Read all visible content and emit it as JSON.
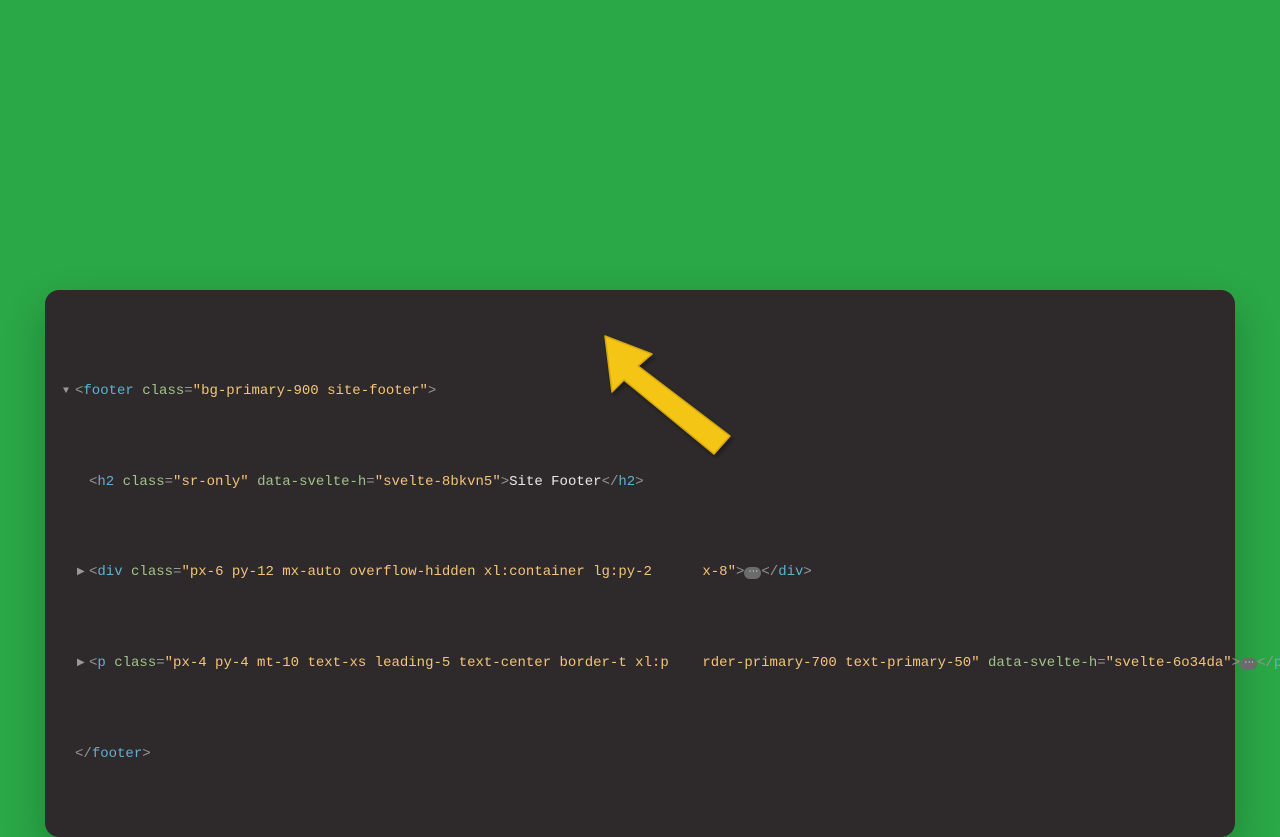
{
  "code": {
    "line1": {
      "disclosure": "▼",
      "open_bracket": "<",
      "tag": "footer",
      "attr1_name": "class",
      "attr1_val": "bg-primary-900 site-footer",
      "close_bracket": ">"
    },
    "line2": {
      "open_bracket": "<",
      "tag": "h2",
      "attr1_name": "class",
      "attr1_val": "sr-only",
      "attr2_name": "data-svelte-h",
      "attr2_val": "svelte-8bkvn5",
      "close_bracket": ">",
      "text": "Site Footer",
      "close_open": "</",
      "close_tag": "h2",
      "close_close": ">"
    },
    "line3": {
      "disclosure": "▶",
      "open_bracket": "<",
      "tag": "div",
      "attr1_name": "class",
      "attr1_val_a": "px-6 py-12 mx-auto overflow-hidden xl:container lg:py-2",
      "attr1_val_b": "x-8",
      "close_bracket": ">",
      "ellipsis": "⋯",
      "close_open": "</",
      "close_tag": "div",
      "close_close": ">"
    },
    "line4": {
      "disclosure": "▶",
      "open_bracket": "<",
      "tag": "p",
      "attr1_name": "class",
      "attr1_val_a": "px-4 py-4 mt-10 text-xs leading-5 text-center border-t xl:p",
      "attr1_val_b": "rder-primary-700 text-primary-50",
      "attr2_name": "data-svelte-h",
      "attr2_val": "svelte-6o34da",
      "close_bracket": ">",
      "ellipsis": "⋯",
      "close_open": "</",
      "close_tag": "p",
      "close_close": ">"
    },
    "line5": {
      "close_open": "</",
      "close_tag": "footer",
      "close_close": ">"
    }
  }
}
